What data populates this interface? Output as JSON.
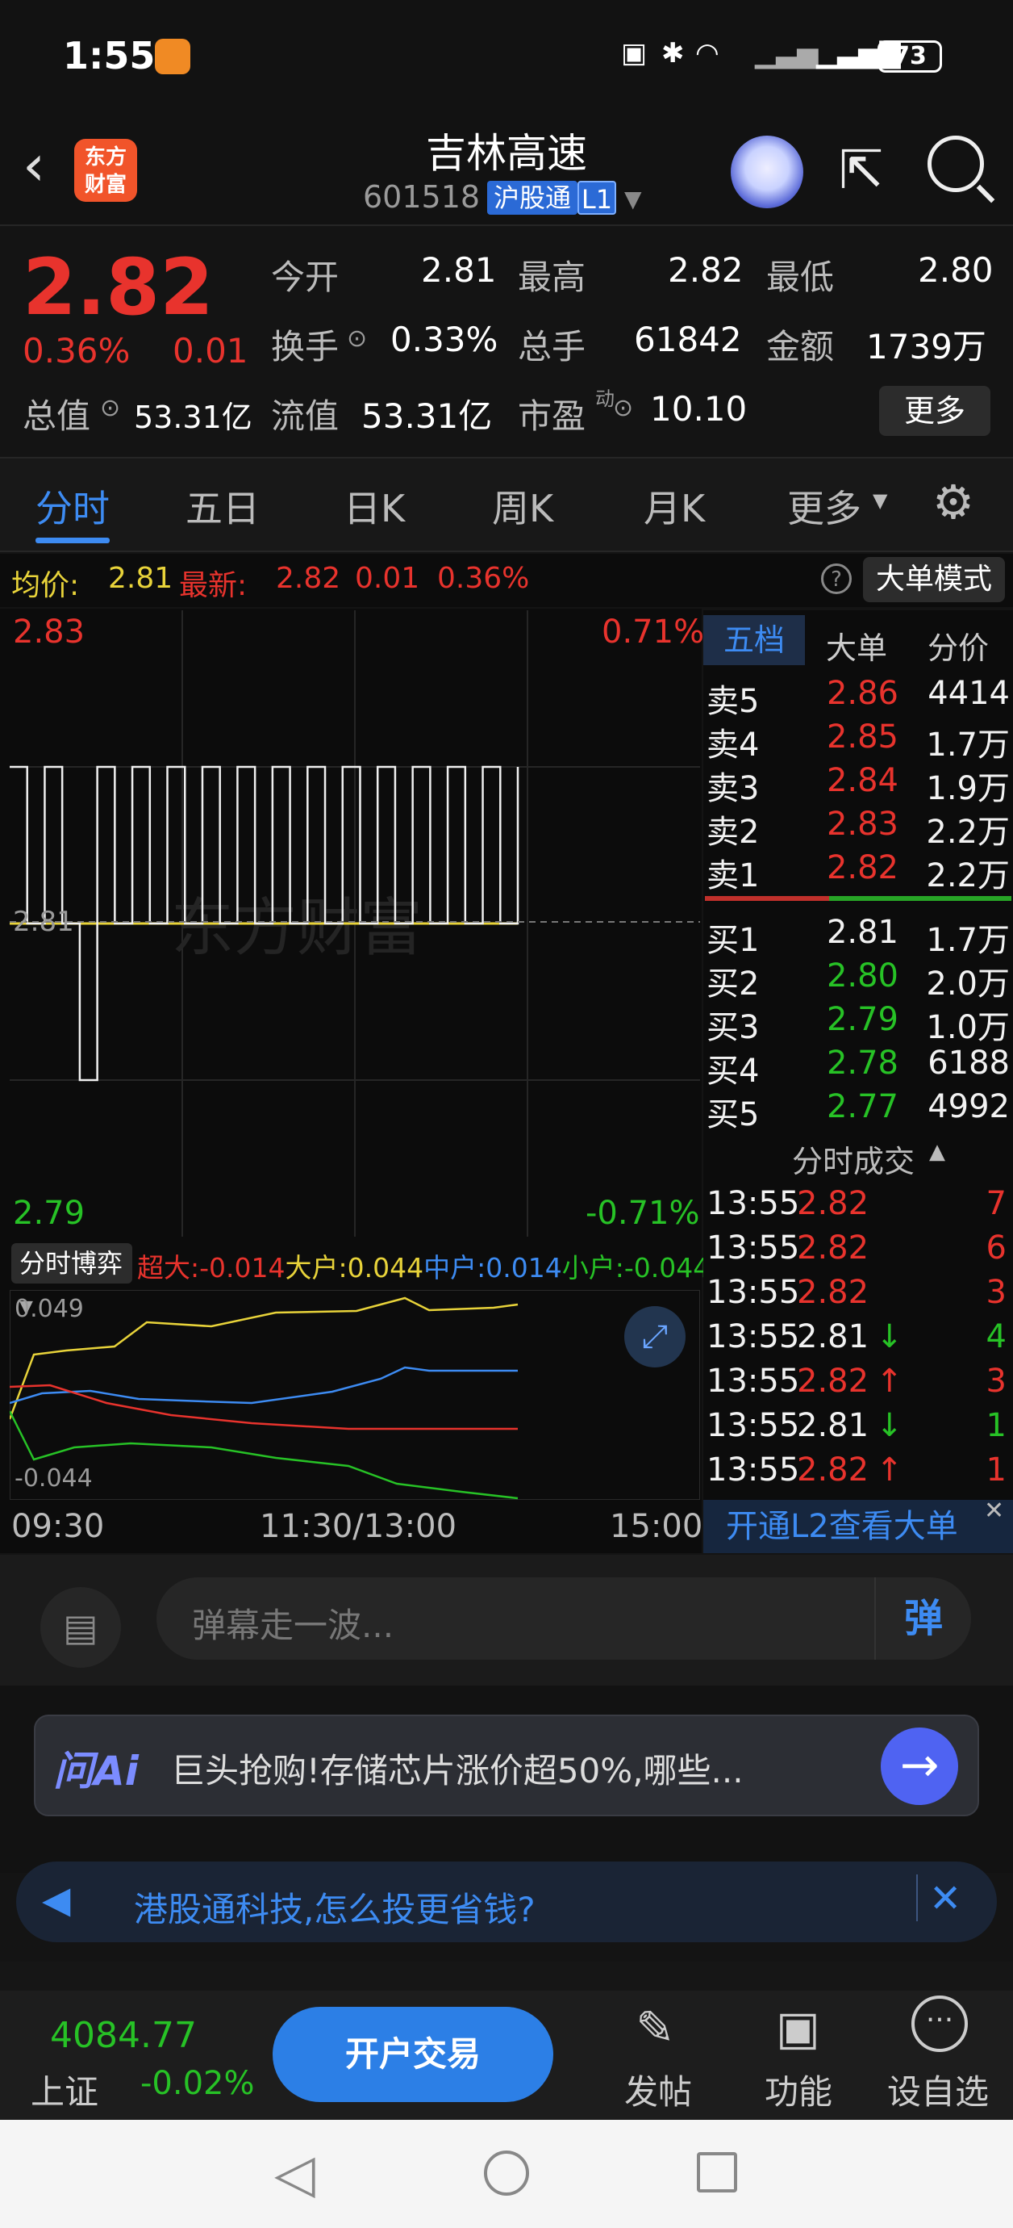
{
  "status_bar": {
    "time": "1:55",
    "battery": "73"
  },
  "header": {
    "back_icon": "chevron-left-icon",
    "logo_line1": "东方",
    "logo_line2": "财富",
    "title": "吉林高速",
    "code": "601518",
    "badge_hgt": "沪股通",
    "badge_level": "L1"
  },
  "quote": {
    "price": "2.82",
    "change_pct": "0.36%",
    "change": "0.01",
    "open_label": "今开",
    "open": "2.81",
    "high_label": "最高",
    "high": "2.82",
    "low_label": "最低",
    "low": "2.80",
    "turnover_label": "换手",
    "turnover": "0.33%",
    "volume_label": "总手",
    "volume": "61842",
    "amount_label": "金额",
    "amount": "1739万",
    "mktcap_label": "总值",
    "mktcap": "53.31亿",
    "float_label": "流值",
    "float": "53.31亿",
    "pe_label": "市盈",
    "pe_sup": "动",
    "pe": "10.10",
    "more_label": "更多"
  },
  "tabs": [
    "分时",
    "五日",
    "日K",
    "周K",
    "月K",
    "更多"
  ],
  "info_line": {
    "avg_label": "均价:",
    "avg": "2.81",
    "latest_label": "最新:",
    "latest": "2.82",
    "chg": "0.01",
    "pct": "0.36%",
    "big_mode": "大单模式"
  },
  "chart": {
    "y_top": "2.83",
    "y_mid": "2.81",
    "y_bottom": "2.79",
    "pct_top": "0.71%",
    "pct_bottom": "-0.71%",
    "watermark": "东方财富",
    "x_start": "09:30",
    "x_mid": "11:30/13:00",
    "x_end": "15:00"
  },
  "chart_data": {
    "type": "line",
    "title": "",
    "ylim": [
      2.79,
      2.83
    ],
    "series": [
      {
        "name": "",
        "values": [
          2.82,
          2.81,
          2.82,
          2.81,
          2.8,
          2.82,
          2.81,
          2.82,
          2.81,
          2.82,
          2.81,
          2.82,
          2.81,
          2.82,
          2.81,
          2.82,
          2.81,
          2.82,
          2.81,
          2.82,
          2.81,
          2.82,
          2.81,
          2.82,
          2.81,
          2.82,
          2.81,
          2.82,
          2.81,
          2.82
        ]
      },
      {
        "name": "",
        "values": [
          2.81,
          2.81,
          2.81,
          2.81,
          2.81,
          2.81,
          2.81,
          2.81,
          2.81,
          2.81,
          2.81,
          2.81,
          2.81,
          2.81,
          2.81,
          2.81,
          2.81,
          2.81,
          2.81,
          2.81,
          2.81,
          2.81,
          2.81,
          2.81,
          2.81,
          2.81,
          2.81,
          2.81,
          2.81,
          2.81
        ]
      }
    ]
  },
  "sub_chart": {
    "selector": "分时博弈",
    "super_label": "超大:",
    "super_val": "-0.014",
    "big_label": "大户:",
    "big_val": "0.044",
    "mid_label": "中户:",
    "mid_val": "0.014",
    "small_label": "小户:",
    "small_val": "-0.044",
    "y_top": "0.049",
    "y_bottom": "-0.044"
  },
  "book": {
    "tabs": [
      "五档",
      "大单",
      "分价"
    ],
    "asks": [
      {
        "label": "卖5",
        "price": "2.86",
        "vol": "4414"
      },
      {
        "label": "卖4",
        "price": "2.85",
        "vol": "1.7万"
      },
      {
        "label": "卖3",
        "price": "2.84",
        "vol": "1.9万"
      },
      {
        "label": "卖2",
        "price": "2.83",
        "vol": "2.2万"
      },
      {
        "label": "卖1",
        "price": "2.82",
        "vol": "2.2万"
      }
    ],
    "bids": [
      {
        "label": "买1",
        "price": "2.81",
        "vol": "1.7万"
      },
      {
        "label": "买2",
        "price": "2.80",
        "vol": "2.0万"
      },
      {
        "label": "买3",
        "price": "2.79",
        "vol": "1.0万"
      },
      {
        "label": "买4",
        "price": "2.78",
        "vol": "6188"
      },
      {
        "label": "买5",
        "price": "2.77",
        "vol": "4992"
      }
    ],
    "trades_title": "分时成交",
    "trades": [
      {
        "t": "13:55",
        "p": "2.82",
        "v": "7"
      },
      {
        "t": "13:55",
        "p": "2.82",
        "v": "6"
      },
      {
        "t": "13:55",
        "p": "2.82",
        "v": "3"
      },
      {
        "t": "13:55",
        "p": "2.81",
        "v": "4"
      },
      {
        "t": "13:55",
        "p": "2.82",
        "v": "3"
      },
      {
        "t": "13:55",
        "p": "2.81",
        "v": "1"
      },
      {
        "t": "13:55",
        "p": "2.82",
        "v": "1"
      }
    ],
    "l2_banner": "开通L2查看大单"
  },
  "danmu": {
    "placeholder": "弹幕走一波...",
    "btn": "弹"
  },
  "ai": {
    "logo": "问Ai",
    "text": "巨头抢购!存储芯片涨价超50%,哪些..."
  },
  "notice": {
    "text": "港股通科技,怎么投更省钱?"
  },
  "bottom": {
    "index_value": "4084.77",
    "index_name": "上证",
    "index_chg": "-0.02%",
    "trade_btn": "开户交易",
    "post": "发帖",
    "func": "功能",
    "watch": "设自选"
  }
}
